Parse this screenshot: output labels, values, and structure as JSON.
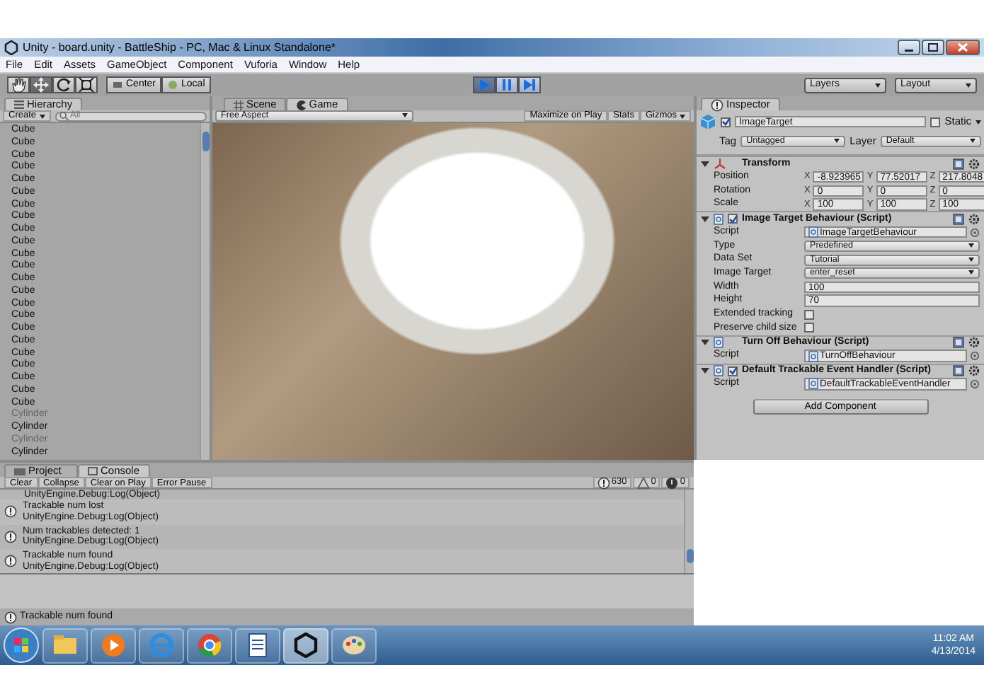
{
  "window": {
    "title": "Unity - board.unity - BattleShip - PC, Mac & Linux Standalone*"
  },
  "menu": [
    "File",
    "Edit",
    "Assets",
    "GameObject",
    "Component",
    "Vuforia",
    "Window",
    "Help"
  ],
  "toolbar": {
    "tools": [
      {
        "kind": "hand",
        "selected": false
      },
      {
        "kind": "move",
        "selected": true
      },
      {
        "kind": "rotate",
        "selected": false
      },
      {
        "kind": "scale",
        "selected": false
      }
    ],
    "pivot": [
      {
        "kind": "center",
        "label": "Center"
      },
      {
        "kind": "local",
        "label": "Local"
      }
    ],
    "play": [
      {
        "kind": "play",
        "selected": true
      },
      {
        "kind": "pause",
        "selected": false
      },
      {
        "kind": "step",
        "selected": false
      }
    ],
    "layers": "Layers",
    "layout": "Layout"
  },
  "hierarchy": {
    "title": "Hierarchy",
    "create": "Create",
    "search_placeholder": "All",
    "items": [
      {
        "label": "Cube",
        "disabled": false
      },
      {
        "label": "Cube",
        "disabled": false
      },
      {
        "label": "Cube",
        "disabled": false
      },
      {
        "label": "Cube",
        "disabled": false
      },
      {
        "label": "Cube",
        "disabled": false
      },
      {
        "label": "Cube",
        "disabled": false
      },
      {
        "label": "Cube",
        "disabled": false
      },
      {
        "label": "Cube",
        "disabled": false
      },
      {
        "label": "Cube",
        "disabled": false
      },
      {
        "label": "Cube",
        "disabled": false
      },
      {
        "label": "Cube",
        "disabled": false
      },
      {
        "label": "Cube",
        "disabled": false
      },
      {
        "label": "Cube",
        "disabled": false
      },
      {
        "label": "Cube",
        "disabled": false
      },
      {
        "label": "Cube",
        "disabled": false
      },
      {
        "label": "Cube",
        "disabled": false
      },
      {
        "label": "Cube",
        "disabled": false
      },
      {
        "label": "Cube",
        "disabled": false
      },
      {
        "label": "Cube",
        "disabled": false
      },
      {
        "label": "Cube",
        "disabled": false
      },
      {
        "label": "Cube",
        "disabled": false
      },
      {
        "label": "Cube",
        "disabled": false
      },
      {
        "label": "Cube",
        "disabled": false
      },
      {
        "label": "Cylinder",
        "disabled": true
      },
      {
        "label": "Cylinder",
        "disabled": false
      },
      {
        "label": "Cylinder",
        "disabled": true
      },
      {
        "label": "Cylinder",
        "disabled": false
      }
    ]
  },
  "game": {
    "tabs": [
      {
        "kind": "scene",
        "label": "Scene",
        "selected": false
      },
      {
        "kind": "game",
        "label": "Game",
        "selected": true
      }
    ],
    "aspect": "Free Aspect",
    "buttons": [
      {
        "label": "Maximize on Play",
        "dropdown": false
      },
      {
        "label": "Stats",
        "dropdown": false
      },
      {
        "label": "Gizmos",
        "dropdown": true
      }
    ]
  },
  "inspector": {
    "title": "Inspector",
    "object_name": "ImageTarget",
    "active": true,
    "static_label": "Static",
    "static": false,
    "tag_label": "Tag",
    "tag": "Untagged",
    "layer_label": "Layer",
    "layer": "Default",
    "components": [
      {
        "title": "Transform",
        "kind": "transform",
        "rows": [
          {
            "kind": "vector",
            "label": "Position",
            "values": [
              {
                "axis": "X",
                "value": "-8.923965"
              },
              {
                "axis": "Y",
                "value": "77.52017"
              },
              {
                "axis": "Z",
                "value": "217.8048"
              }
            ]
          },
          {
            "kind": "vector",
            "label": "Rotation",
            "values": [
              {
                "axis": "X",
                "value": "0"
              },
              {
                "axis": "Y",
                "value": "0"
              },
              {
                "axis": "Z",
                "value": "0"
              }
            ]
          },
          {
            "kind": "vector",
            "label": "Scale",
            "values": [
              {
                "axis": "X",
                "value": "100"
              },
              {
                "axis": "Y",
                "value": "100"
              },
              {
                "axis": "Z",
                "value": "100"
              }
            ]
          }
        ]
      },
      {
        "title": "Image Target Behaviour (Script)",
        "kind": "script",
        "enabled": true,
        "rows": [
          {
            "kind": "object",
            "label": "Script",
            "value": "ImageTargetBehaviour"
          },
          {
            "kind": "dropdown",
            "label": "Type",
            "value": "Predefined"
          },
          {
            "kind": "dropdown",
            "label": "Data Set",
            "value": "Tutorial"
          },
          {
            "kind": "dropdown",
            "label": "Image Target",
            "value": "enter_reset"
          },
          {
            "kind": "text",
            "label": "Width",
            "value": "100"
          },
          {
            "kind": "text",
            "label": "Height",
            "value": "70"
          },
          {
            "kind": "checkbox",
            "label": "Extended tracking",
            "checked": false
          },
          {
            "kind": "checkbox",
            "label": "Preserve child size",
            "checked": false
          }
        ]
      },
      {
        "title": "Turn Off Behaviour (Script)",
        "kind": "script",
        "rows": [
          {
            "kind": "object",
            "label": "Script",
            "value": "TurnOffBehaviour"
          }
        ]
      },
      {
        "title": "Default Trackable Event Handler (Script)",
        "kind": "script",
        "enabled": true,
        "rows": [
          {
            "kind": "object",
            "label": "Script",
            "value": "DefaultTrackableEventHandler"
          }
        ]
      }
    ],
    "add_component": "Add Component"
  },
  "console": {
    "tabs": [
      {
        "label": "Project",
        "selected": false
      },
      {
        "label": "Console",
        "selected": true
      }
    ],
    "buttons": [
      "Clear",
      "Collapse",
      "Clear on Play",
      "Error Pause"
    ],
    "counts": [
      {
        "kind": "info",
        "value": "630"
      },
      {
        "kind": "warning",
        "value": "0"
      },
      {
        "kind": "error",
        "value": "0"
      }
    ],
    "entries": [
      {
        "lines": [
          "UnityEngine.Debug:Log(Object)"
        ]
      },
      {
        "lines": [
          "Trackable num lost",
          "UnityEngine.Debug:Log(Object)"
        ]
      },
      {
        "lines": [
          "Num trackables detected: 1",
          "UnityEngine.Debug:Log(Object)"
        ]
      },
      {
        "lines": [
          "Trackable num found",
          "UnityEngine.Debug:Log(Object)"
        ]
      }
    ]
  },
  "status_bar": "Trackable num found",
  "taskbar": {
    "apps": [
      {
        "kind": "folder",
        "selected": false
      },
      {
        "kind": "media",
        "selected": false
      },
      {
        "kind": "browser-e",
        "selected": false
      },
      {
        "kind": "browser-c",
        "selected": false
      },
      {
        "kind": "document",
        "selected": false
      },
      {
        "kind": "unity",
        "selected": true
      },
      {
        "kind": "paint",
        "selected": false
      }
    ],
    "time": "11:02 AM",
    "date": "4/13/2014"
  }
}
